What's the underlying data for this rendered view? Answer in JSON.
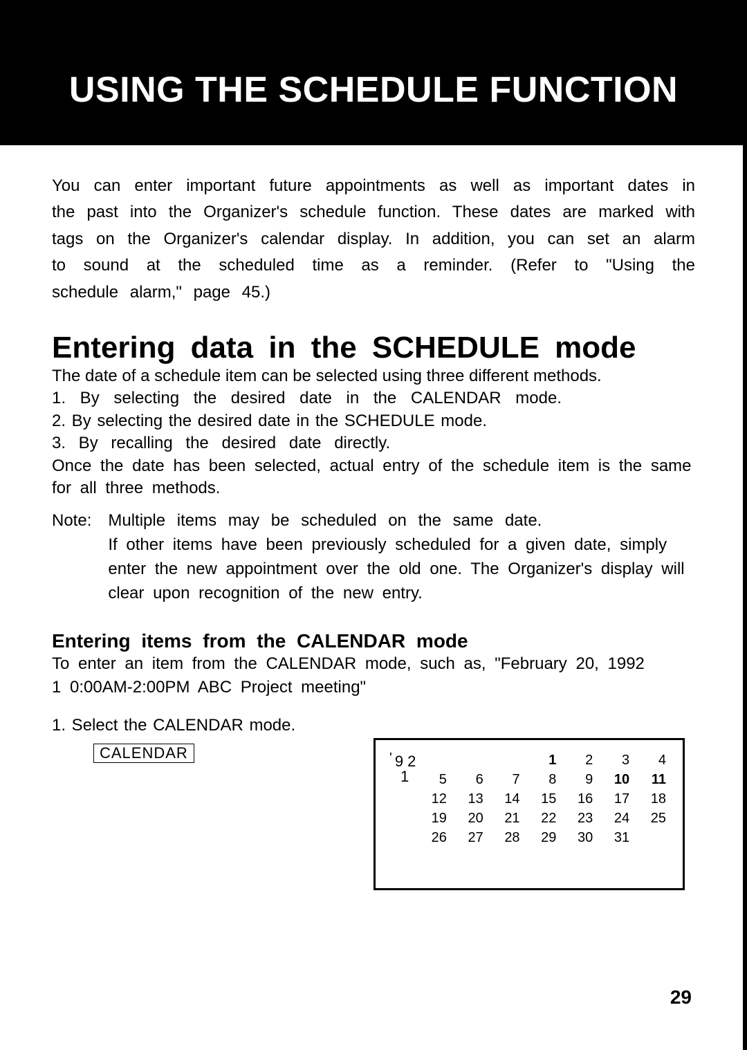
{
  "header": {
    "title": "USING THE SCHEDULE FUNCTION"
  },
  "intro": "You can enter important future appointments as well as important dates in the past into the Organizer's schedule function. These dates are marked with tags on the Organizer's calendar display. In addition, you can set an alarm to sound at the scheduled time as a reminder. (Refer to \"Using the schedule alarm,\" page 45.)",
  "section1": {
    "heading": "Entering data in the SCHEDULE mode",
    "lead": "The date of a schedule item can be selected using three different methods.",
    "items": [
      "1.  By  selecting  the  desired  date  in  the  CALENDAR  mode.",
      "2. By selecting the desired date in the SCHEDULE mode.",
      "3.  By  recalling  the  desired  date  directly."
    ],
    "after": "Once  the  date  has  been  selected,  actual  entry  of  the  schedule  item  is  the same  for  all  three  methods.",
    "noteLabel": "Note:",
    "noteBody1": "Multiple  items  may  be  scheduled  on  the  same  date.",
    "noteBody2": "If  other  items  have  been  previously  scheduled  for  a  given  date, simply enter the new appointment over the old one.    The Organizer's  display  will  clear  upon  recognition  of  the  new  entry."
  },
  "section2": {
    "heading": "Entering items from the CALENDAR mode",
    "p1": "To  enter  an  item  from  the  CALENDAR  mode,  such  as,  \"February  20, 1992",
    "p2": "1 0:00AM-2:00PM  ABC  Project  meeting\"",
    "step1": "1. Select the CALENDAR mode.",
    "keyLabel": "CALENDAR"
  },
  "calendar": {
    "yearPrefix": "'",
    "year1": "9 2",
    "year2": "1",
    "row1": [
      "",
      "",
      "",
      "1",
      "2",
      "3",
      "4"
    ],
    "row2": [
      "5",
      "6",
      "7",
      "8",
      "9",
      "10",
      "11"
    ],
    "row3": [
      "12",
      "13",
      "14",
      "15",
      "16",
      "17",
      "18"
    ],
    "row4": [
      "19",
      "20",
      "21",
      "22",
      "23",
      "24",
      "25"
    ],
    "row5": [
      "26",
      "27",
      "28",
      "29",
      "30",
      "31",
      ""
    ],
    "boldCells": [
      "1",
      "10",
      "11"
    ]
  },
  "pageNumber": "29"
}
